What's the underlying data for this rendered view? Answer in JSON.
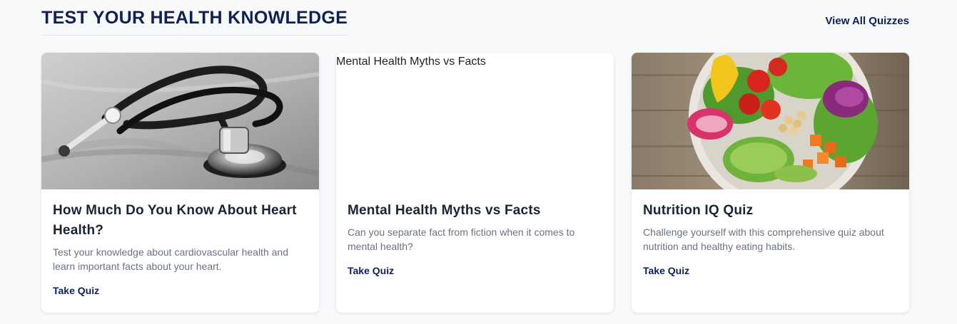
{
  "section": {
    "title": "TEST YOUR HEALTH KNOWLEDGE",
    "view_all_label": "View All Quizzes"
  },
  "cards": [
    {
      "image_alt": "",
      "image_subject": "stethoscope-photo",
      "title": "How Much Do You Know About Heart Health?",
      "description": "Test your knowledge about cardiovascular health and learn important facts about your heart.",
      "cta_label": "Take Quiz"
    },
    {
      "image_alt": "Mental Health Myths vs Facts",
      "image_subject": "broken-image",
      "title": "Mental Health Myths vs Facts",
      "description": "Can you separate fact from fiction when it comes to mental health?",
      "cta_label": "Take Quiz"
    },
    {
      "image_alt": "",
      "image_subject": "salad-bowl-photo",
      "title": "Nutrition IQ Quiz",
      "description": "Challenge yourself with this comprehensive quiz about nutrition and healthy eating habits.",
      "cta_label": "Take Quiz"
    }
  ],
  "colors": {
    "heading": "#0e2150",
    "card_title": "#1b2435",
    "body_text": "#6b7380",
    "page_bg": "#f8f9fb"
  }
}
